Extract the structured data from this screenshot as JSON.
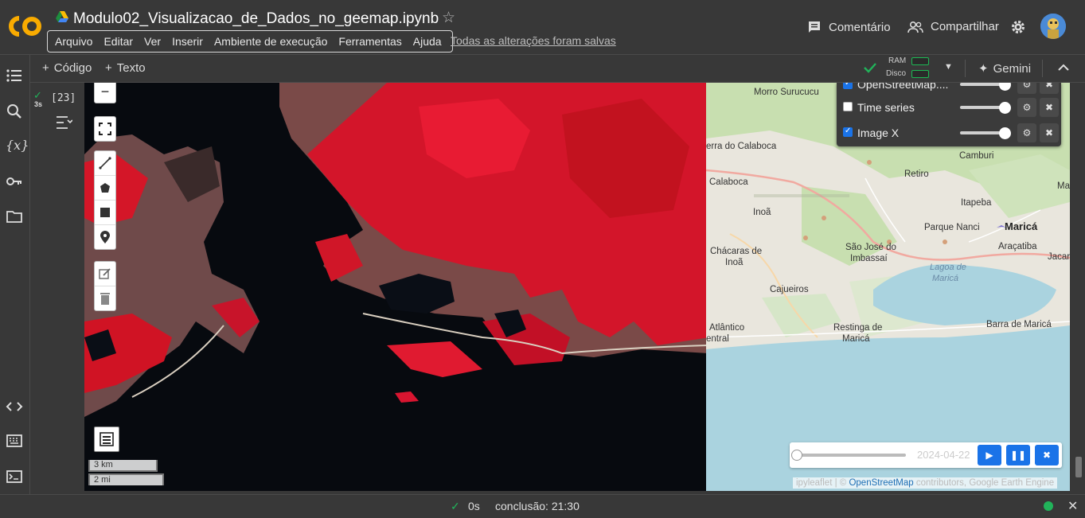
{
  "header": {
    "title": "Modulo02_Visualizacao_de_Dados_no_geemap.ipynb",
    "menu": [
      "Arquivo",
      "Editar",
      "Ver",
      "Inserir",
      "Ambiente de execução",
      "Ferramentas",
      "Ajuda"
    ],
    "saved_status": "Todas as alterações foram salvas",
    "comment_label": "Comentário",
    "share_label": "Compartilhar"
  },
  "toolbar": {
    "add_code": "Código",
    "add_text": "Texto",
    "ram_label": "RAM",
    "disk_label": "Disco",
    "gemini_label": "Gemini"
  },
  "cell": {
    "exec_count": "[23]",
    "exec_time": "3s"
  },
  "map": {
    "layers": [
      {
        "name": "OpenStreetMap....",
        "checked": true
      },
      {
        "name": "Time series",
        "checked": false
      },
      {
        "name": "Image X",
        "checked": true
      }
    ],
    "places": {
      "morro": "Morro Surucucu",
      "serra": "erra do Calaboca",
      "calaboca": "Calaboca",
      "inoa": "Inoã",
      "retiro": "Retiro",
      "camburi": "Camburi",
      "itapeba": "Itapeba",
      "parque": "Parque Nanci",
      "marica": "Maricá",
      "aracatiba": "Araçatiba",
      "jacare": "Jacaré",
      "chacaras1": "Chácaras de",
      "chacaras2": "Inoã",
      "saojose1": "São José do",
      "saojose2": "Imbassaí",
      "cajueiros": "Cajueiros",
      "lagoa1": "Lagoa de",
      "lagoa2": "Maricá",
      "atlantico1": "Atlântico",
      "atlantico2": "entral",
      "restinga1": "Restinga de",
      "restinga2": "Maricá",
      "barra": "Barra de Maricá",
      "ma": "Ma"
    },
    "time_slider_date": "2024-04-22",
    "attribution_prefix": "ipyleaflet | ©",
    "attribution_link": "OpenStreetMap",
    "attribution_suffix": "contributors, Google Earth Engine",
    "scale_km": "3 km",
    "scale_mi": "2 mi"
  },
  "status": {
    "time": "0s",
    "conclusion": "conclusão: 21:30"
  }
}
